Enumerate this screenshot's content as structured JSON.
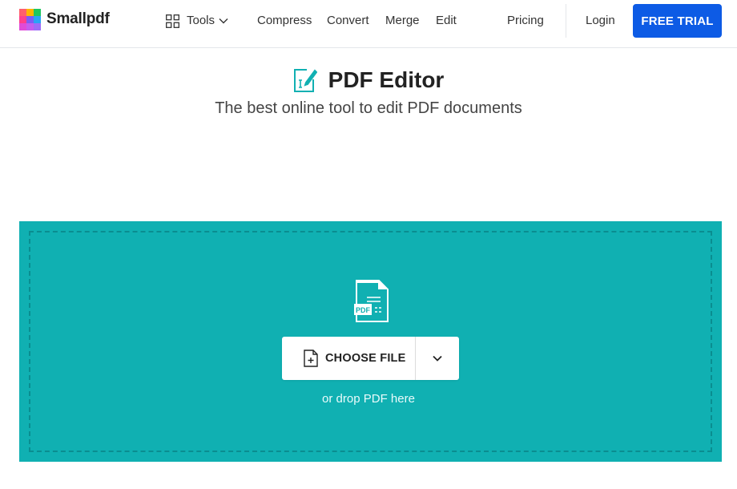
{
  "brand": {
    "name": "Smallpdf",
    "logo_colors": [
      "#ff5f6d",
      "#ffb400",
      "#1ec760",
      "#ff3f8e",
      "#7b5cf5",
      "#2aa4f4",
      "#c45cf0",
      "#e04bd8",
      "#9d6cf7"
    ]
  },
  "nav": {
    "tools_label": "Tools",
    "items": [
      "Compress",
      "Convert",
      "Merge",
      "Edit"
    ],
    "pricing": "Pricing",
    "login": "Login",
    "cta": "FREE TRIAL"
  },
  "hero": {
    "icon": "edit-document-icon",
    "title": "PDF Editor",
    "subtitle": "The best online tool to edit PDF documents"
  },
  "upload": {
    "file_icon_badge": "PDF",
    "choose_label": "CHOOSE FILE",
    "drop_hint": "or drop PDF here"
  },
  "colors": {
    "accent": "#10b0b2",
    "accent_dark": "#0a8d90",
    "cta": "#0d5be5"
  }
}
